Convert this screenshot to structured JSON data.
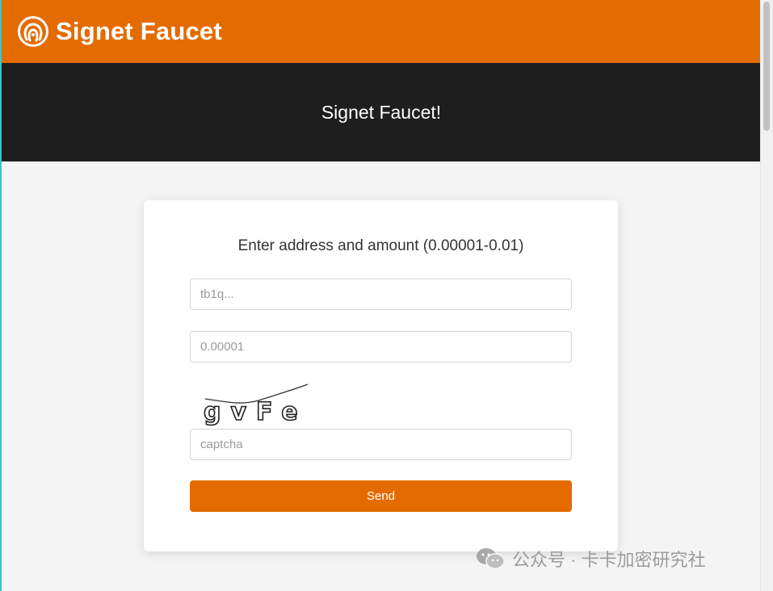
{
  "navbar": {
    "brand_name": "Signet Faucet",
    "brand_color": "#e46b00",
    "logo_icon": "faucet-logo-icon"
  },
  "hero": {
    "title": "Signet Faucet!",
    "background": "#1e1e1e"
  },
  "form": {
    "heading": "Enter address and amount (0.00001-0.01)",
    "address_placeholder": "tb1q...",
    "address_value": "",
    "amount_placeholder": "0.00001",
    "amount_value": "",
    "captcha_text": "gvFe",
    "captcha_placeholder": "captcha",
    "captcha_value": "",
    "send_label": "Send",
    "button_color": "#e46b00"
  },
  "watermark": {
    "text": "公众号 · 卡卡加密研究社",
    "icon": "wechat-icon"
  }
}
